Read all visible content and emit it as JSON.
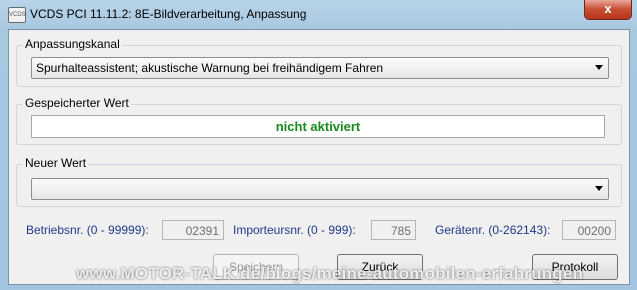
{
  "window": {
    "app_icon_text": "VCDS",
    "title": "VCDS PCI 11.11.2: 8E-Bildverarbeitung,  Anpassung",
    "close_label": "x"
  },
  "channel_group": {
    "label": "Anpassungskanal",
    "selected_value": "Spurhalteassistent; akustische Warnung bei freihändigem Fahren"
  },
  "stored_group": {
    "label": "Gespeicherter Wert",
    "value": "nicht aktiviert",
    "value_color": "#1a8a1a"
  },
  "new_group": {
    "label": "Neuer Wert",
    "selected_value": ""
  },
  "fields": {
    "betriebsnr_label": "Betriebsnr. (0 - 99999):",
    "betriebsnr_value": "02391",
    "importeursnr_label": "Importeursnr. (0 - 999):",
    "importeursnr_value": "785",
    "geraetenr_label": "Gerätenr. (0-262143):",
    "geraetenr_value": "00200"
  },
  "buttons": {
    "speichern": "Speichern",
    "zurueck": "Zurück",
    "protokoll": "Protokoll"
  },
  "watermark": "www.MOTOR-TALK.de/blogs/meine-automobilen-erfahrungen",
  "colors": {
    "label_blue": "#1f3a8a",
    "close_red": "#c74b33"
  }
}
